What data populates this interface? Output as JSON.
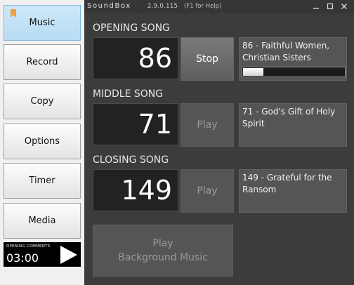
{
  "nav": {
    "items": [
      {
        "label": "Music",
        "active": true
      },
      {
        "label": "Record",
        "active": false
      },
      {
        "label": "Copy",
        "active": false
      },
      {
        "label": "Options",
        "active": false
      },
      {
        "label": "Timer",
        "active": false
      },
      {
        "label": "Media",
        "active": false
      }
    ]
  },
  "timer": {
    "label": "OPENING COMMENTS",
    "time": "03:00",
    "icon": "play-icon"
  },
  "titlebar": {
    "app_name": "SoundBox",
    "version": "2.9.0.115",
    "help": "(F1 for Help)",
    "controls": [
      "minimize-icon",
      "maximize-icon",
      "close-icon"
    ]
  },
  "songs": {
    "opening": {
      "label": "OPENING SONG",
      "number": "86",
      "action": "Stop",
      "title": "86 - Faithful Women, Christian Sisters",
      "progress": 0.2
    },
    "middle": {
      "label": "MIDDLE SONG",
      "number": "71",
      "action": "Play",
      "title": "71 - God's Gift of Holy Spirit"
    },
    "closing": {
      "label": "CLOSING SONG",
      "number": "149",
      "action": "Play",
      "title": "149 - Grateful for the Ransom"
    }
  },
  "background_music": {
    "line1": "Play",
    "line2": "Background Music"
  },
  "colors": {
    "nav_active": "#b8dcf3",
    "panel": "#3c3c3c",
    "bookmark": "#f0a040"
  }
}
